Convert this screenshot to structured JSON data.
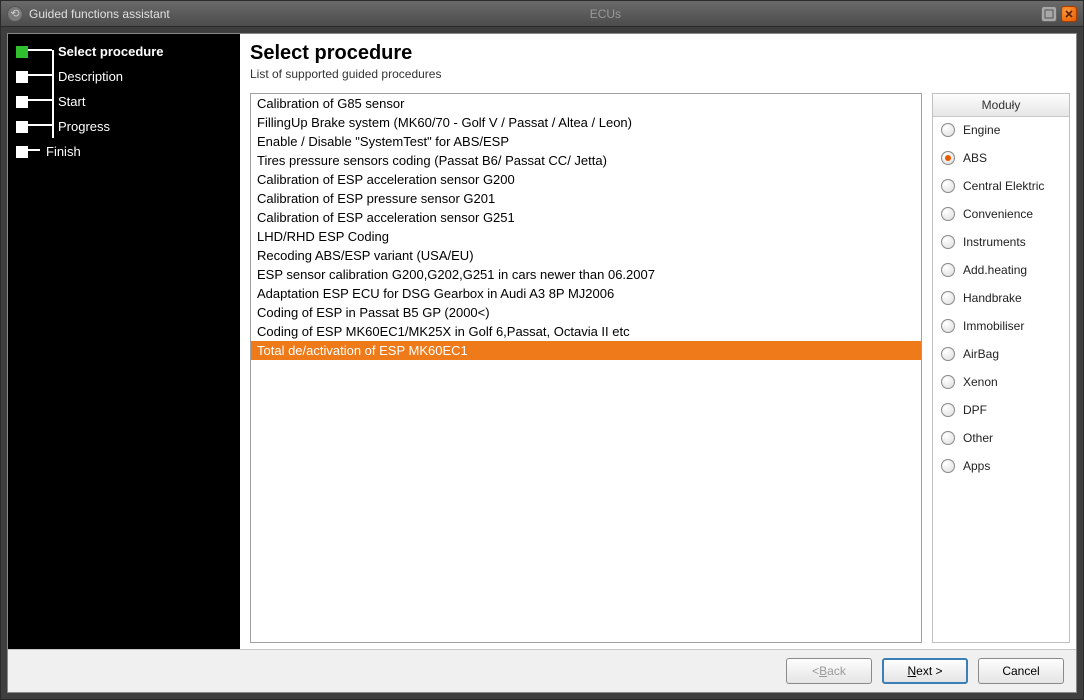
{
  "window": {
    "title": "Guided functions assistant",
    "center_hint": "ECUs"
  },
  "sidebar": {
    "steps": [
      {
        "label": "Select procedure",
        "active": true
      },
      {
        "label": "Description",
        "active": false
      },
      {
        "label": "Start",
        "active": false
      },
      {
        "label": "Progress",
        "active": false
      },
      {
        "label": "Finish",
        "active": false,
        "last": true
      }
    ]
  },
  "header": {
    "title": "Select procedure",
    "subtitle": "List of supported guided procedures"
  },
  "procedures": [
    {
      "label": "Calibration of G85 sensor",
      "selected": false
    },
    {
      "label": "FillingUp Brake system (MK60/70 - Golf V / Passat / Altea / Leon)",
      "selected": false
    },
    {
      "label": "Enable / Disable \"SystemTest\" for ABS/ESP",
      "selected": false
    },
    {
      "label": "Tires pressure sensors coding (Passat B6/ Passat CC/ Jetta)",
      "selected": false
    },
    {
      "label": "Calibration of ESP acceleration sensor G200",
      "selected": false
    },
    {
      "label": "Calibration of ESP pressure sensor G201",
      "selected": false
    },
    {
      "label": "Calibration of ESP acceleration sensor G251",
      "selected": false
    },
    {
      "label": "LHD/RHD ESP Coding",
      "selected": false
    },
    {
      "label": "Recoding ABS/ESP variant (USA/EU)",
      "selected": false
    },
    {
      "label": "ESP sensor calibration G200,G202,G251 in cars newer than 06.2007",
      "selected": false
    },
    {
      "label": "Adaptation ESP ECU for DSG Gearbox in Audi A3 8P MJ2006",
      "selected": false
    },
    {
      "label": "Coding of ESP in Passat B5 GP (2000<)",
      "selected": false
    },
    {
      "label": "Coding of ESP MK60EC1/MK25X in Golf 6,Passat, Octavia II etc",
      "selected": false
    },
    {
      "label": "Total de/activation of ESP MK60EC1",
      "selected": true
    }
  ],
  "modules": {
    "header": "Moduły",
    "items": [
      {
        "label": "Engine",
        "selected": false
      },
      {
        "label": "ABS",
        "selected": true
      },
      {
        "label": "Central Elektric",
        "selected": false
      },
      {
        "label": "Convenience",
        "selected": false
      },
      {
        "label": "Instruments",
        "selected": false
      },
      {
        "label": "Add.heating",
        "selected": false
      },
      {
        "label": "Handbrake",
        "selected": false
      },
      {
        "label": "Immobiliser",
        "selected": false
      },
      {
        "label": "AirBag",
        "selected": false
      },
      {
        "label": "Xenon",
        "selected": false
      },
      {
        "label": "DPF",
        "selected": false
      },
      {
        "label": "Other",
        "selected": false
      },
      {
        "label": "Apps",
        "selected": false
      }
    ]
  },
  "footer": {
    "back_prefix": "< ",
    "back_hotkey": "B",
    "back_suffix": "ack",
    "next_hotkey": "N",
    "next_suffix": "ext >",
    "cancel": "Cancel"
  }
}
